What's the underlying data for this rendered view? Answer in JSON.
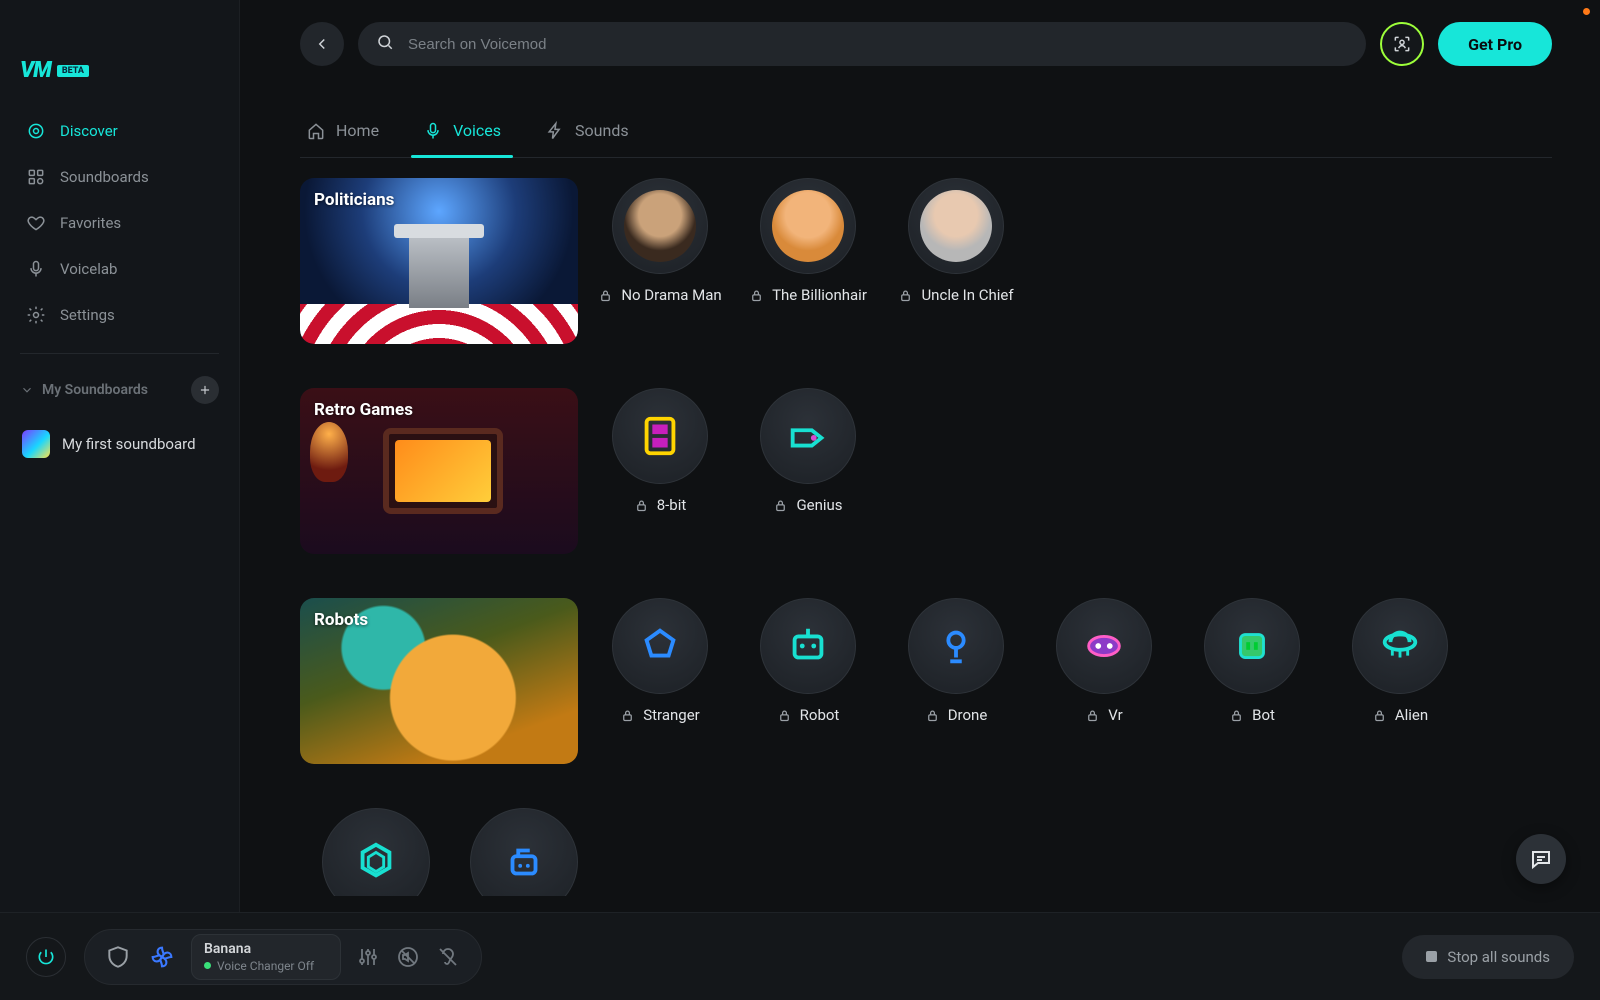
{
  "app": {
    "name": "VM",
    "badge": "BETA"
  },
  "header": {
    "search_placeholder": "Search on Voicemod",
    "pro_button": "Get Pro"
  },
  "sidebar": {
    "items": [
      {
        "id": "discover",
        "label": "Discover",
        "icon": "target-icon",
        "active": true
      },
      {
        "id": "soundboards",
        "label": "Soundboards",
        "icon": "grid-icon",
        "active": false
      },
      {
        "id": "favorites",
        "label": "Favorites",
        "icon": "heart-icon",
        "active": false
      },
      {
        "id": "voicelab",
        "label": "Voicelab",
        "icon": "mic-icon",
        "active": false
      },
      {
        "id": "settings",
        "label": "Settings",
        "icon": "gear-icon",
        "active": false
      }
    ],
    "my_soundboards_title": "My Soundboards",
    "my_soundboards": [
      {
        "label": "My first soundboard"
      }
    ]
  },
  "tabs": [
    {
      "id": "home",
      "label": "Home",
      "icon": "home-icon",
      "active": false
    },
    {
      "id": "voices",
      "label": "Voices",
      "icon": "voice-icon",
      "active": true
    },
    {
      "id": "sounds",
      "label": "Sounds",
      "icon": "bolt-icon",
      "active": false
    }
  ],
  "categories": [
    {
      "id": "politicians",
      "title": "Politicians",
      "voices": [
        {
          "label": "No Drama Man",
          "locked": true,
          "icon": "face-obama"
        },
        {
          "label": "The Billionhair",
          "locked": true,
          "icon": "face-trump"
        },
        {
          "label": "Uncle In Chief",
          "locked": true,
          "icon": "face-biden"
        }
      ]
    },
    {
      "id": "retro",
      "title": "Retro Games",
      "voices": [
        {
          "label": "8-bit",
          "locked": true,
          "icon": "glyph-8bit"
        },
        {
          "label": "Genius",
          "locked": true,
          "icon": "glyph-genius"
        }
      ]
    },
    {
      "id": "robots",
      "title": "Robots",
      "voices": [
        {
          "label": "Stranger",
          "locked": true,
          "icon": "glyph-stranger"
        },
        {
          "label": "Robot",
          "locked": true,
          "icon": "glyph-robot"
        },
        {
          "label": "Drone",
          "locked": true,
          "icon": "glyph-drone"
        },
        {
          "label": "Vr",
          "locked": true,
          "icon": "glyph-vr"
        },
        {
          "label": "Bot",
          "locked": true,
          "icon": "glyph-bot"
        },
        {
          "label": "Alien",
          "locked": true,
          "icon": "glyph-alien"
        }
      ]
    }
  ],
  "footer": {
    "current_voice": "Banana",
    "status_text": "Voice Changer Off",
    "stop_label": "Stop all sounds"
  }
}
